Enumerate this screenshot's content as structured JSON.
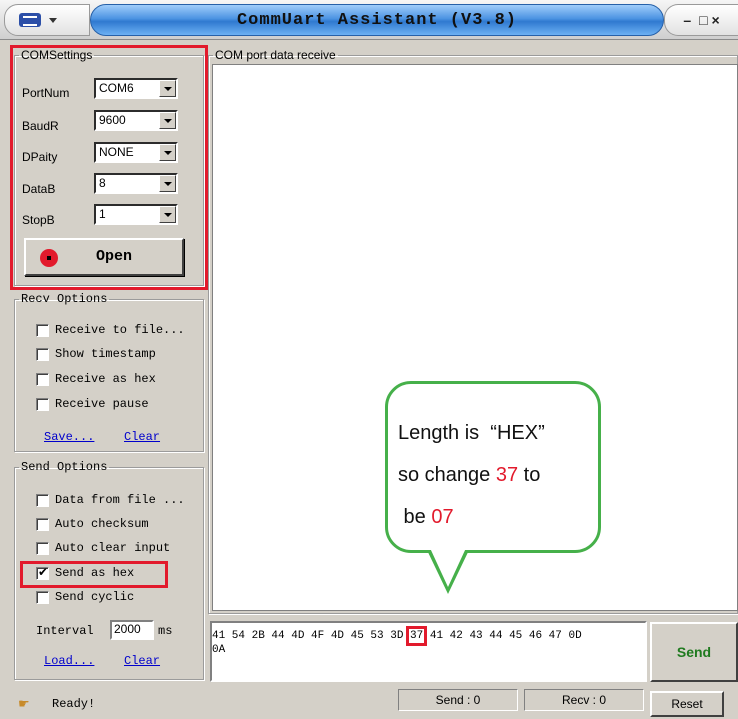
{
  "window": {
    "title": "CommUart Assistant (V3.8)",
    "controls": {
      "minimize": "–",
      "close": "□ ×"
    }
  },
  "com_settings": {
    "legend": "COMSettings",
    "fields": [
      {
        "label": "PortNum",
        "value": "COM6"
      },
      {
        "label": "BaudR",
        "value": "9600"
      },
      {
        "label": "DPaity",
        "value": "NONE"
      },
      {
        "label": "DataB",
        "value": "8"
      },
      {
        "label": "StopB",
        "value": "1"
      }
    ],
    "open_label": "Open"
  },
  "recv_options": {
    "legend": "Recv Options",
    "checkboxes": [
      {
        "label": "Receive to file...",
        "checked": false
      },
      {
        "label": "Show timestamp",
        "checked": false
      },
      {
        "label": "Receive as hex",
        "checked": false
      },
      {
        "label": "Receive pause",
        "checked": false
      }
    ],
    "save_link": "Save...",
    "clear_link": "Clear"
  },
  "send_options": {
    "legend": "Send Options",
    "checkboxes": [
      {
        "label": "Data from file ...",
        "checked": false
      },
      {
        "label": "Auto checksum",
        "checked": false
      },
      {
        "label": "Auto clear input",
        "checked": false
      },
      {
        "label": "Send as hex",
        "checked": true
      },
      {
        "label": "Send cyclic",
        "checked": false
      }
    ],
    "interval_label": "Interval",
    "interval_value": "2000",
    "interval_unit": "ms",
    "load_link": "Load...",
    "clear_link": "Clear"
  },
  "recv_area": {
    "legend": "COM port data receive"
  },
  "callout": {
    "line1_a": "Length is  “HEX”",
    "line2_a": "so change ",
    "line2_b": "37",
    "line2_c": " to",
    "line3_a": " be ",
    "line3_b": "07"
  },
  "send_input": {
    "line1_before": "41 54 2B 44 4D 4F 4D 45 53 3D ",
    "line1_highlight": "37",
    "line1_after": " 41 42 43 44 45 46 47 0D",
    "line2": "0A"
  },
  "send_label": "Send",
  "status": {
    "text": "Ready!",
    "send_count": "Send : 0",
    "recv_count": "Recv : 0",
    "reset_label": "Reset"
  },
  "colors": {
    "highlight_red": "#e21a2c",
    "callout_green": "#46b04a",
    "send_green": "#1f7a1f"
  }
}
